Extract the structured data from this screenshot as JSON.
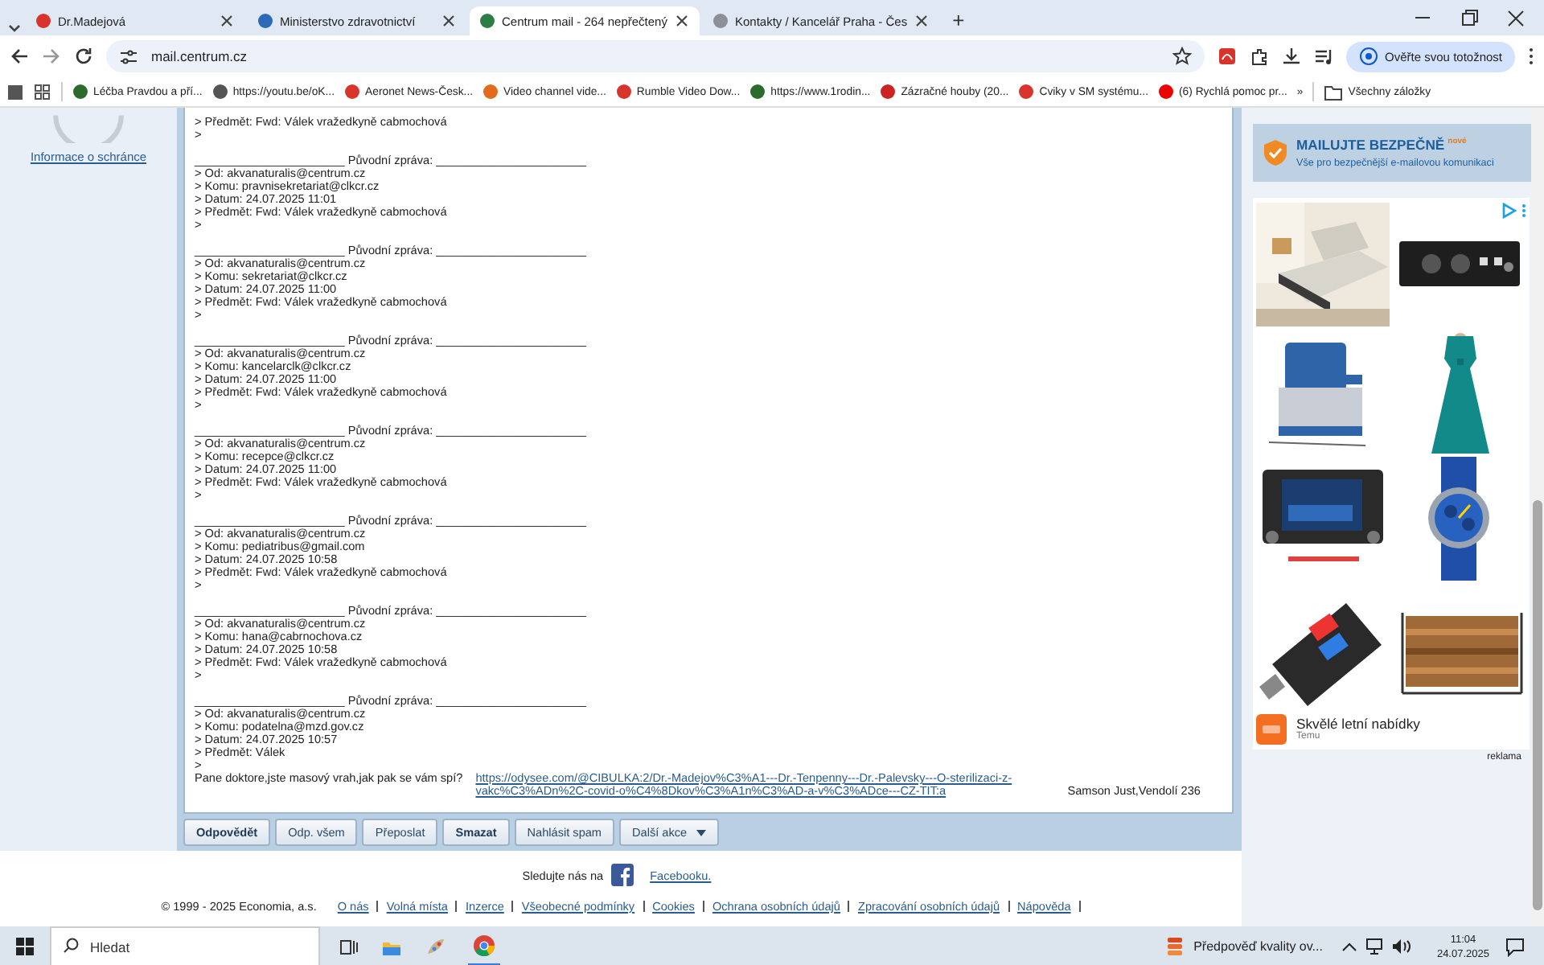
{
  "browser": {
    "tabs": [
      {
        "title": "Dr.Madejová",
        "selected": false
      },
      {
        "title": "Ministerstvo zdravotnictví",
        "selected": false
      },
      {
        "title": "Centrum mail - 264 nepřečtený",
        "selected": true
      },
      {
        "title": "Kontakty / Kancelář Praha - Čes",
        "selected": false
      }
    ],
    "new_tab": "+",
    "address": "mail.centrum.cz",
    "identity_button": "Ověřte svou totožnost",
    "bookmarks": [
      "Léčba Pravdou a pří...",
      "https://youtu.be/oK...",
      "Aeronet News-Česk...",
      "Video channel vide...",
      "Rumble Video Dow...",
      "https://www.1rodin...",
      "Zázračné houby (20...",
      "Cviky v SM systému...",
      "(6) Rychlá pomoc pr..."
    ],
    "bookmarks_more": "»",
    "all_bookmarks": "Všechny záložky"
  },
  "sidebar": {
    "info_link": "Informace o schránce"
  },
  "message": {
    "top_lines": [
      "> Předmět: Fwd: Válek vražedkyně cabmochová",
      ">"
    ],
    "quoted": [
      {
        "separator": "_______________________ Původní zpráva: _______________________",
        "lines": [
          "> Od: akvanaturalis@centrum.cz",
          "> Komu: pravnisekretariat@clkcr.cz",
          "> Datum: 24.07.2025 11:01",
          "> Předmět: Fwd: Válek vražedkyně cabmochová",
          ">"
        ]
      },
      {
        "separator": "_______________________ Původní zpráva: _______________________",
        "lines": [
          "> Od: akvanaturalis@centrum.cz",
          "> Komu: sekretariat@clkcr.cz",
          "> Datum: 24.07.2025 11:00",
          "> Předmět: Fwd: Válek vražedkyně cabmochová",
          ">"
        ]
      },
      {
        "separator": "_______________________ Původní zpráva: _______________________",
        "lines": [
          "> Od: akvanaturalis@centrum.cz",
          "> Komu: kancelarclk@clkcr.cz",
          "> Datum: 24.07.2025 11:00",
          "> Předmět: Fwd: Válek vražedkyně cabmochová",
          ">"
        ]
      },
      {
        "separator": "_______________________ Původní zpráva: _______________________",
        "lines": [
          "> Od: akvanaturalis@centrum.cz",
          "> Komu: recepce@clkcr.cz",
          "> Datum: 24.07.2025 11:00",
          "> Předmět: Fwd: Válek vražedkyně cabmochová",
          ">"
        ]
      },
      {
        "separator": "_______________________ Původní zpráva: _______________________",
        "lines": [
          "> Od: akvanaturalis@centrum.cz",
          "> Komu: pediatribus@gmail.com",
          "> Datum: 24.07.2025 10:58",
          "> Předmět: Fwd: Válek vražedkyně cabmochová",
          ">"
        ]
      },
      {
        "separator": "_______________________ Původní zpráva: _______________________",
        "lines": [
          "> Od: akvanaturalis@centrum.cz",
          "> Komu: hana@cabrnochova.cz",
          "> Datum: 24.07.2025 10:58",
          "> Předmět: Fwd: Válek vražedkyně cabmochová",
          ">"
        ]
      },
      {
        "separator": "_______________________ Původní zpráva: _______________________",
        "lines": [
          "> Od: akvanaturalis@centrum.cz",
          "> Komu: podatelna@mzd.gov.cz",
          "> Datum: 24.07.2025 10:57",
          "> Předmět: Válek",
          ">"
        ]
      }
    ],
    "closing": {
      "text": "Pane doktore,jste masový vrah,jak pak se vám spí?",
      "link": "https://odysee.com/@CIBULKA:2/Dr.-Madejov%C3%A1---Dr.-Tenpenny---Dr.-Palevsky---O-sterilizaci-z-vakc%C3%ADn%2C-covid-o%C4%8Dkov%C3%A1n%C3%AD-a-v%C3%ADce---CZ-TIT:a",
      "signature": "Samson Just,Vendolí 236"
    }
  },
  "actions": [
    {
      "label": "Odpovědět",
      "kind": "bold"
    },
    {
      "label": "Odp. všem",
      "kind": "plain"
    },
    {
      "label": "Přeposlat",
      "kind": "plain"
    },
    {
      "label": "Smazat",
      "kind": "bold"
    },
    {
      "label": "Nahlásit spam",
      "kind": "plain"
    },
    {
      "label": "Další akce",
      "kind": "menu"
    }
  ],
  "ads": {
    "banner": {
      "title": "MAILUJTE BEZPEČNĚ",
      "badge": "nové",
      "subtitle": "Vše pro bezpečnější e-mailovou komunikaci"
    },
    "offer": {
      "title": "Skvělé letní nabídky",
      "advertiser": "Temu"
    },
    "label": "reklama"
  },
  "footer": {
    "follow_text": "Sledujte nás na",
    "facebook_link": "Facebooku.",
    "copyright": "© 1999 - 2025 Economia, a.s.",
    "links": [
      "O nás",
      "Volná místa",
      "Inzerce",
      "Všeobecné podmínky",
      "Cookies",
      "Ochrana osobních údajů",
      "Zpracování osobních údajů",
      "Nápověda"
    ]
  },
  "taskbar": {
    "search_placeholder": "Hledat",
    "weather": "Předpověď kvality ov...",
    "time": "11:04",
    "date": "24.07.2025"
  }
}
